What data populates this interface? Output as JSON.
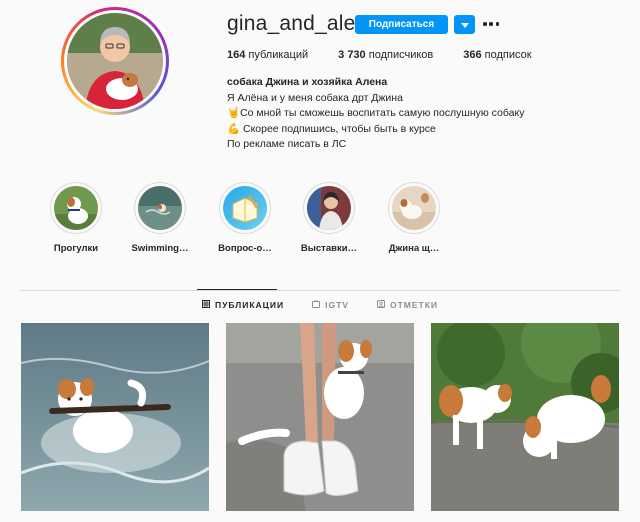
{
  "profile": {
    "username": "gina_and_alena",
    "follow_label": "Подписаться",
    "avatar_icon": "profile-photo",
    "stats": {
      "posts_count": "164",
      "posts_label": "публикаций",
      "followers_count": "3 730",
      "followers_label": "подписчиков",
      "following_count": "366",
      "following_label": "подписок"
    },
    "bio": {
      "full_name": "собака Джина и хозяйка Алена",
      "lines": [
        "Я Алёна и у меня собака дрт Джина",
        "🤘Со мной ты сможешь воспитать самую послушную собаку",
        "💪 Скорее подпишись, чтобы быть в курсе",
        "По рекламе писать в ЛС"
      ]
    }
  },
  "highlights": [
    {
      "label": "Прогулки"
    },
    {
      "label": "Swimming…"
    },
    {
      "label": "Вопрос-о…"
    },
    {
      "label": "Выставки…"
    },
    {
      "label": "Джина щ…"
    }
  ],
  "tabs": [
    {
      "label": "ПУБЛИКАЦИИ",
      "icon": "grid-icon",
      "active": true
    },
    {
      "label": "IGTV",
      "icon": "igtv-icon",
      "active": false
    },
    {
      "label": "ОТМЕТКИ",
      "icon": "tag-icon",
      "active": false
    }
  ],
  "colors": {
    "accent": "#0095f6",
    "text": "#262626",
    "muted": "#8e8e8e",
    "border": "#dbdbdb",
    "background": "#fafafa"
  }
}
